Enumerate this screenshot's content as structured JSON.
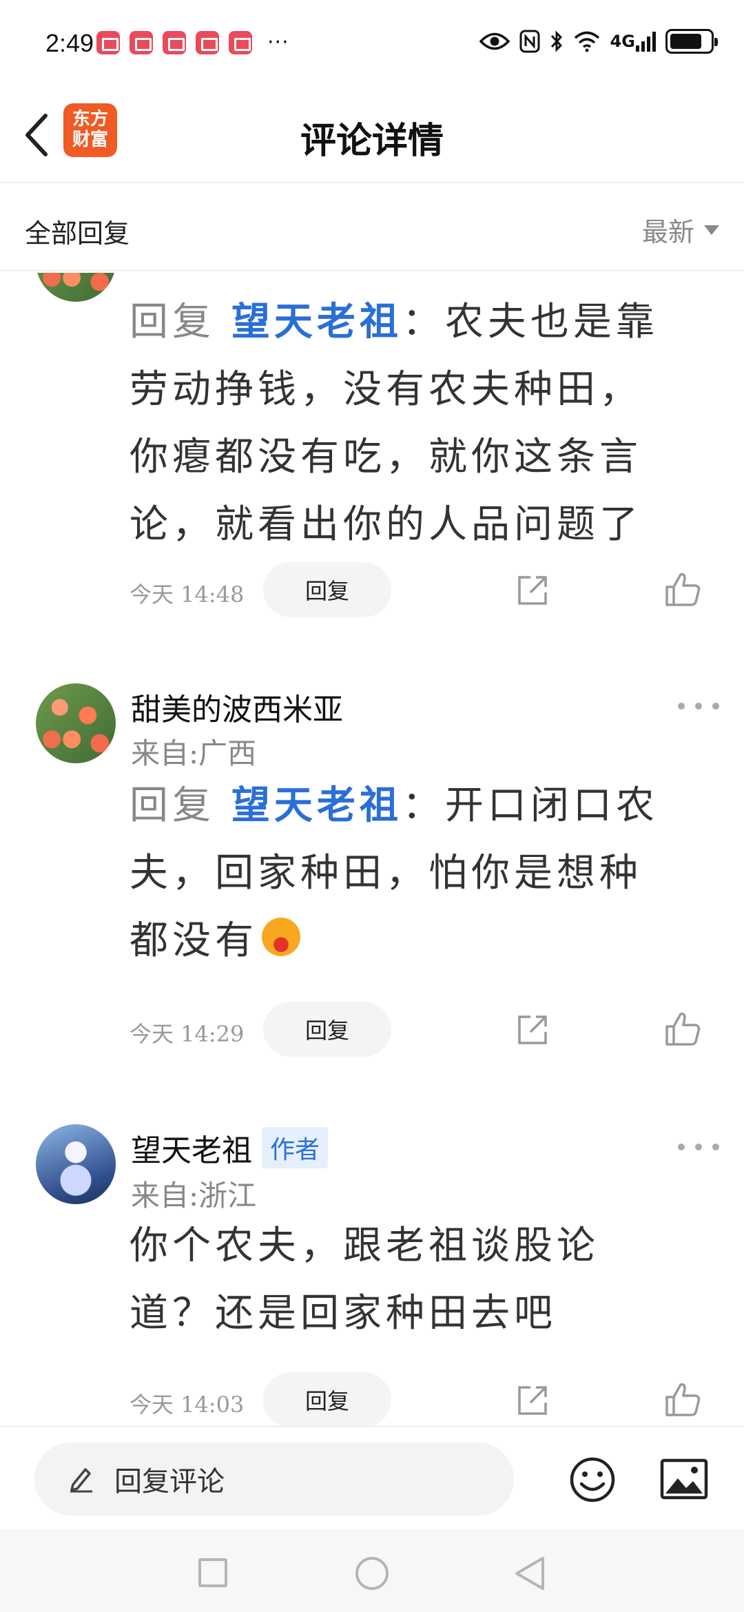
{
  "status_bar": {
    "time": "2:49",
    "network": "4G",
    "app_icons": [
      "reading-app-icon",
      "huawei-app-icon",
      "reading-app-icon",
      "reading-app-icon",
      "reading-app-icon"
    ],
    "more": "···"
  },
  "header": {
    "title": "评论详情",
    "logo_text_line1": "东方",
    "logo_text_line2": "财富",
    "brand_color": "#f05a24"
  },
  "filter": {
    "label": "全部回复",
    "sort_label": "最新"
  },
  "colors": {
    "mention": "#2a6fd6",
    "muted": "#888888",
    "reply_button_bg": "#f3f4f6"
  },
  "comments": [
    {
      "body_prefix": "回复",
      "mention": "望天老祖",
      "body_lines": [
        "：农夫也是靠",
        "劳动挣钱，没有农夫种田，",
        "你瘪都没有吃，就你这条言",
        "论，就看出你的人品问题了"
      ],
      "time": "今天  14:48",
      "reply_label": "回复"
    },
    {
      "name": "甜美的波西米亚",
      "location": "来自:广西",
      "body_prefix": "回复",
      "mention": "望天老祖",
      "body_lines": [
        "：开口闭口农",
        "夫，回家种田，怕你是想种",
        "都没有"
      ],
      "emoji": "laughing-emoji",
      "time": "今天  14:29",
      "reply_label": "回复"
    },
    {
      "name": "望天老祖",
      "author_badge": "作者",
      "location": "来自:浙江",
      "body_lines": [
        "你个农夫，跟老祖谈股论",
        "道？还是回家种田去吧"
      ],
      "time": "今天  14:03",
      "reply_label": "回复"
    }
  ],
  "input_bar": {
    "placeholder": "回复评论"
  }
}
